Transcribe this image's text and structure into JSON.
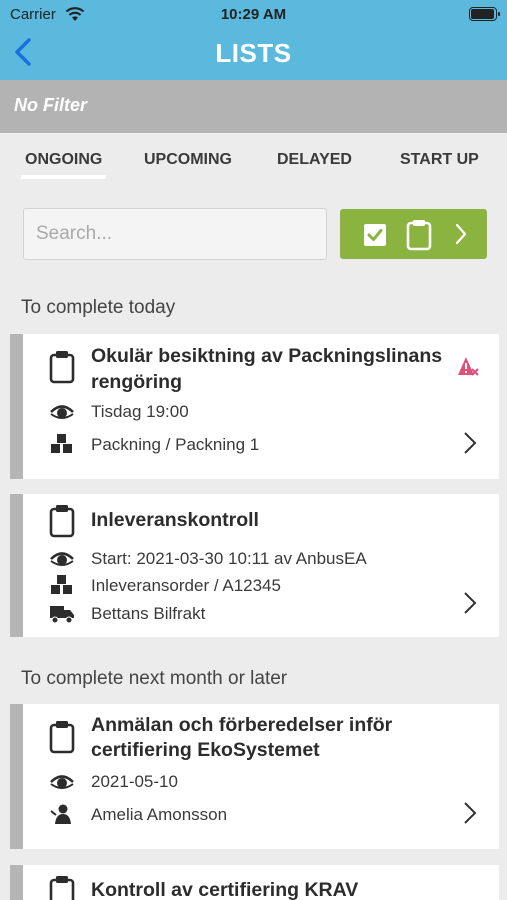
{
  "status_bar": {
    "carrier": "Carrier",
    "time": "10:29 AM"
  },
  "header": {
    "title": "LISTS"
  },
  "filter": {
    "label": "No Filter"
  },
  "tabs": [
    {
      "label": "ONGOING"
    },
    {
      "label": "UPCOMING"
    },
    {
      "label": "DELAYED"
    },
    {
      "label": "START UP"
    }
  ],
  "search": {
    "placeholder": "Search...",
    "value": ""
  },
  "sections": {
    "today": "To complete today",
    "later": "To complete next month or later"
  },
  "cards": [
    {
      "title_line1": "Okulär besiktning av Packningslinans",
      "title_line2": "rengöring",
      "time": "Tisdag 19:00",
      "location": "Packning / Packning 1"
    },
    {
      "title": "Inleveranskontroll",
      "time": "Start: 2021-03-30 10:11  av AnbusEA",
      "location": "Inleveransorder / A12345",
      "supplier": "Bettans Bilfrakt"
    },
    {
      "title_line1": "Anmälan och förberedelser inför",
      "title_line2": "certifiering EkoSystemet",
      "time": "2021-05-10",
      "person": "Amelia Amonsson"
    },
    {
      "title": "Kontroll av certifiering KRAV"
    }
  ],
  "colors": {
    "header": "#5bb9de",
    "accent_green": "#8ab33f",
    "warning": "#e0507a"
  }
}
